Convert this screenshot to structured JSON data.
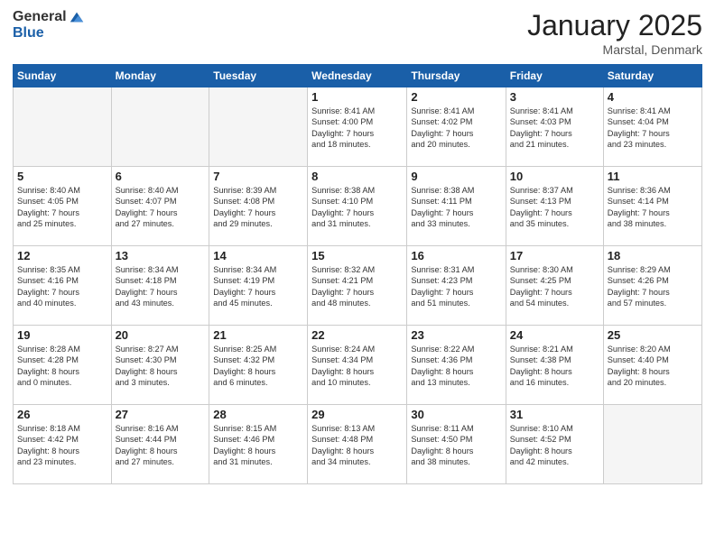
{
  "logo": {
    "general": "General",
    "blue": "Blue"
  },
  "title": "January 2025",
  "location": "Marstal, Denmark",
  "days_header": [
    "Sunday",
    "Monday",
    "Tuesday",
    "Wednesday",
    "Thursday",
    "Friday",
    "Saturday"
  ],
  "weeks": [
    [
      {
        "num": "",
        "info": ""
      },
      {
        "num": "",
        "info": ""
      },
      {
        "num": "",
        "info": ""
      },
      {
        "num": "1",
        "info": "Sunrise: 8:41 AM\nSunset: 4:00 PM\nDaylight: 7 hours\nand 18 minutes."
      },
      {
        "num": "2",
        "info": "Sunrise: 8:41 AM\nSunset: 4:02 PM\nDaylight: 7 hours\nand 20 minutes."
      },
      {
        "num": "3",
        "info": "Sunrise: 8:41 AM\nSunset: 4:03 PM\nDaylight: 7 hours\nand 21 minutes."
      },
      {
        "num": "4",
        "info": "Sunrise: 8:41 AM\nSunset: 4:04 PM\nDaylight: 7 hours\nand 23 minutes."
      }
    ],
    [
      {
        "num": "5",
        "info": "Sunrise: 8:40 AM\nSunset: 4:05 PM\nDaylight: 7 hours\nand 25 minutes."
      },
      {
        "num": "6",
        "info": "Sunrise: 8:40 AM\nSunset: 4:07 PM\nDaylight: 7 hours\nand 27 minutes."
      },
      {
        "num": "7",
        "info": "Sunrise: 8:39 AM\nSunset: 4:08 PM\nDaylight: 7 hours\nand 29 minutes."
      },
      {
        "num": "8",
        "info": "Sunrise: 8:38 AM\nSunset: 4:10 PM\nDaylight: 7 hours\nand 31 minutes."
      },
      {
        "num": "9",
        "info": "Sunrise: 8:38 AM\nSunset: 4:11 PM\nDaylight: 7 hours\nand 33 minutes."
      },
      {
        "num": "10",
        "info": "Sunrise: 8:37 AM\nSunset: 4:13 PM\nDaylight: 7 hours\nand 35 minutes."
      },
      {
        "num": "11",
        "info": "Sunrise: 8:36 AM\nSunset: 4:14 PM\nDaylight: 7 hours\nand 38 minutes."
      }
    ],
    [
      {
        "num": "12",
        "info": "Sunrise: 8:35 AM\nSunset: 4:16 PM\nDaylight: 7 hours\nand 40 minutes."
      },
      {
        "num": "13",
        "info": "Sunrise: 8:34 AM\nSunset: 4:18 PM\nDaylight: 7 hours\nand 43 minutes."
      },
      {
        "num": "14",
        "info": "Sunrise: 8:34 AM\nSunset: 4:19 PM\nDaylight: 7 hours\nand 45 minutes."
      },
      {
        "num": "15",
        "info": "Sunrise: 8:32 AM\nSunset: 4:21 PM\nDaylight: 7 hours\nand 48 minutes."
      },
      {
        "num": "16",
        "info": "Sunrise: 8:31 AM\nSunset: 4:23 PM\nDaylight: 7 hours\nand 51 minutes."
      },
      {
        "num": "17",
        "info": "Sunrise: 8:30 AM\nSunset: 4:25 PM\nDaylight: 7 hours\nand 54 minutes."
      },
      {
        "num": "18",
        "info": "Sunrise: 8:29 AM\nSunset: 4:26 PM\nDaylight: 7 hours\nand 57 minutes."
      }
    ],
    [
      {
        "num": "19",
        "info": "Sunrise: 8:28 AM\nSunset: 4:28 PM\nDaylight: 8 hours\nand 0 minutes."
      },
      {
        "num": "20",
        "info": "Sunrise: 8:27 AM\nSunset: 4:30 PM\nDaylight: 8 hours\nand 3 minutes."
      },
      {
        "num": "21",
        "info": "Sunrise: 8:25 AM\nSunset: 4:32 PM\nDaylight: 8 hours\nand 6 minutes."
      },
      {
        "num": "22",
        "info": "Sunrise: 8:24 AM\nSunset: 4:34 PM\nDaylight: 8 hours\nand 10 minutes."
      },
      {
        "num": "23",
        "info": "Sunrise: 8:22 AM\nSunset: 4:36 PM\nDaylight: 8 hours\nand 13 minutes."
      },
      {
        "num": "24",
        "info": "Sunrise: 8:21 AM\nSunset: 4:38 PM\nDaylight: 8 hours\nand 16 minutes."
      },
      {
        "num": "25",
        "info": "Sunrise: 8:20 AM\nSunset: 4:40 PM\nDaylight: 8 hours\nand 20 minutes."
      }
    ],
    [
      {
        "num": "26",
        "info": "Sunrise: 8:18 AM\nSunset: 4:42 PM\nDaylight: 8 hours\nand 23 minutes."
      },
      {
        "num": "27",
        "info": "Sunrise: 8:16 AM\nSunset: 4:44 PM\nDaylight: 8 hours\nand 27 minutes."
      },
      {
        "num": "28",
        "info": "Sunrise: 8:15 AM\nSunset: 4:46 PM\nDaylight: 8 hours\nand 31 minutes."
      },
      {
        "num": "29",
        "info": "Sunrise: 8:13 AM\nSunset: 4:48 PM\nDaylight: 8 hours\nand 34 minutes."
      },
      {
        "num": "30",
        "info": "Sunrise: 8:11 AM\nSunset: 4:50 PM\nDaylight: 8 hours\nand 38 minutes."
      },
      {
        "num": "31",
        "info": "Sunrise: 8:10 AM\nSunset: 4:52 PM\nDaylight: 8 hours\nand 42 minutes."
      },
      {
        "num": "",
        "info": ""
      }
    ]
  ]
}
